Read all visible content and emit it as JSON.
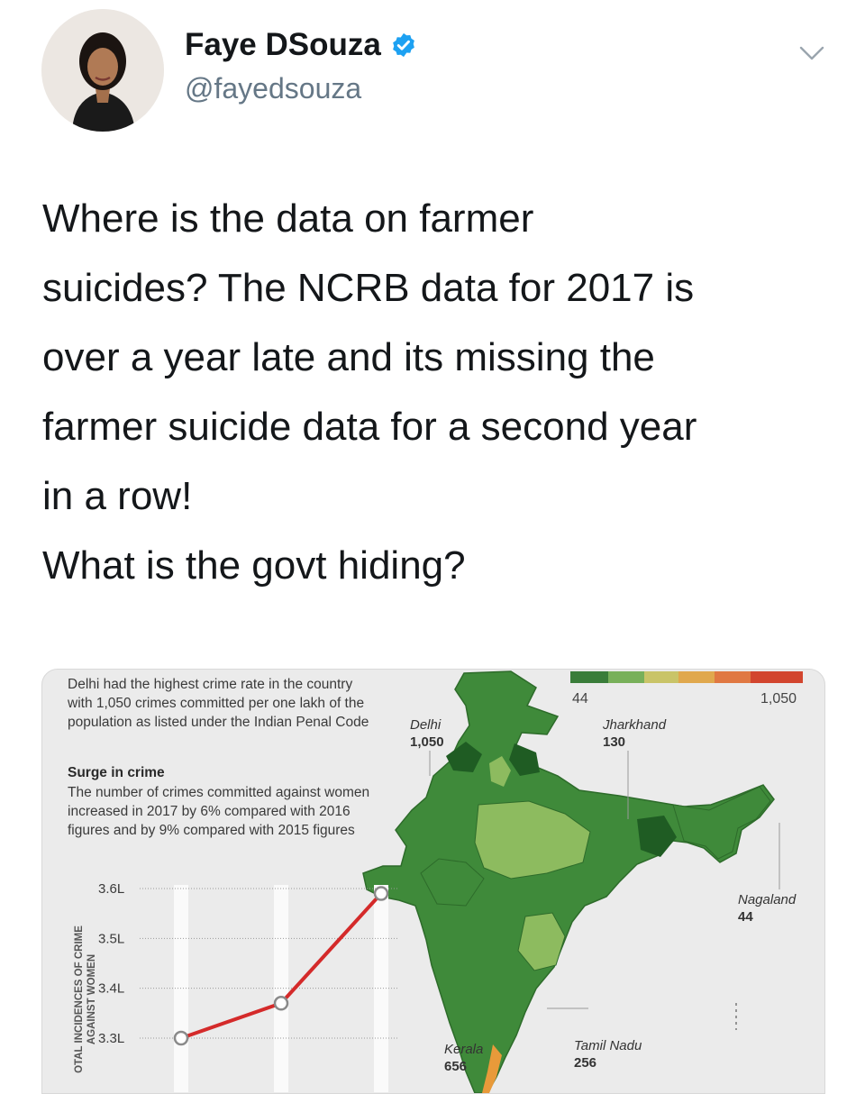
{
  "tweet": {
    "author_name": "Faye DSouza",
    "handle": "@fayedsouza",
    "verified": true,
    "lines": [
      "Where is the data on farmer",
      "suicides? The NCRB data for 2017 is",
      "over a year late and its missing the",
      "farmer suicide data for a second year",
      "in a row!",
      "What is the govt hiding?"
    ]
  },
  "icons": {
    "verified": "verified-badge-icon",
    "menu": "chevron-down-icon"
  },
  "colors": {
    "verified_blue": "#1da1f2",
    "line_red": "#d42a2a",
    "map_green": "#3f8a3a",
    "map_light_green": "#8dbb5f",
    "map_dark_green": "#1f5c23"
  },
  "infographic": {
    "intro": "Delhi had the highest crime rate in the country with 1,050 crimes committed per one lakh of the population as listed under the Indian Penal Code",
    "surge_title": "Surge in crime",
    "surge_body": "The number of crimes committed against women increased in 2017 by 6% compared with 2016 figures and by 9% compared with 2015 figures",
    "vertical_label_1": "OTAL INCIDENCES OF CRIME",
    "vertical_label_2": "AGAINST WOMEN",
    "legend": {
      "min": "44",
      "max": "1,050"
    },
    "map_labels": [
      {
        "name": "Delhi",
        "value": "1,050"
      },
      {
        "name": "Jharkhand",
        "value": "130"
      },
      {
        "name": "Nagaland",
        "value": "44"
      },
      {
        "name": "Kerala",
        "value": "656"
      },
      {
        "name": "Tamil Nadu",
        "value": "256"
      }
    ]
  },
  "chart_data": {
    "type": "line",
    "y_tick_labels": [
      "3.6L",
      "3.5L",
      "3.4L",
      "3.3L"
    ],
    "ylim": [
      3.3,
      3.6
    ],
    "series": [
      {
        "values": [
          3.3,
          3.37,
          3.59
        ]
      }
    ]
  }
}
